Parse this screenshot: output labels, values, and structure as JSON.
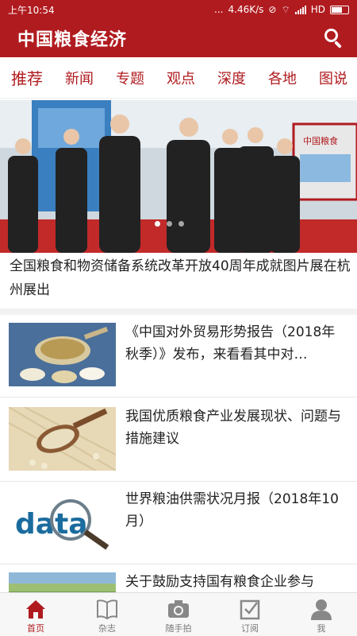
{
  "status_bar": {
    "time": "上午10:54",
    "dots": "...",
    "speed": "4.46K/s",
    "network": "HD"
  },
  "header": {
    "title": "中国粮食经济"
  },
  "tabs": [
    {
      "label": "推荐",
      "active": true
    },
    {
      "label": "新闻"
    },
    {
      "label": "专题"
    },
    {
      "label": "观点"
    },
    {
      "label": "深度"
    },
    {
      "label": "各地"
    },
    {
      "label": "图说"
    }
  ],
  "hero": {
    "caption": "全国粮食和物资储备系统改革开放40周年成就图片展在杭州展出",
    "slide_count": 3,
    "active_slide": 1,
    "poster_text": "中国粮食"
  },
  "articles": [
    {
      "title": "《中国对外贸易形势报告（2018年秋季）》发布，来看看其中对…",
      "thumb": "grain-spoon-blue"
    },
    {
      "title": "我国优质粮食产业发展现状、问题与措施建议",
      "thumb": "grain-spoon-burlap"
    },
    {
      "title": "世界粮油供需状况月报（2018年10月）",
      "thumb": "data-magnifier",
      "thumb_text": "data"
    },
    {
      "title": "关于鼓励支持国有粮食企业参与",
      "thumb": "rice-field"
    }
  ],
  "bottom_nav": [
    {
      "label": "首页",
      "icon": "home-icon",
      "active": true
    },
    {
      "label": "杂志",
      "icon": "magazine-icon"
    },
    {
      "label": "随手拍",
      "icon": "camera-icon"
    },
    {
      "label": "订阅",
      "icon": "subscribe-icon"
    },
    {
      "label": "我",
      "icon": "user-icon"
    }
  ],
  "colors": {
    "brand_red": "#b01b1f",
    "nav_gray": "#777777"
  }
}
